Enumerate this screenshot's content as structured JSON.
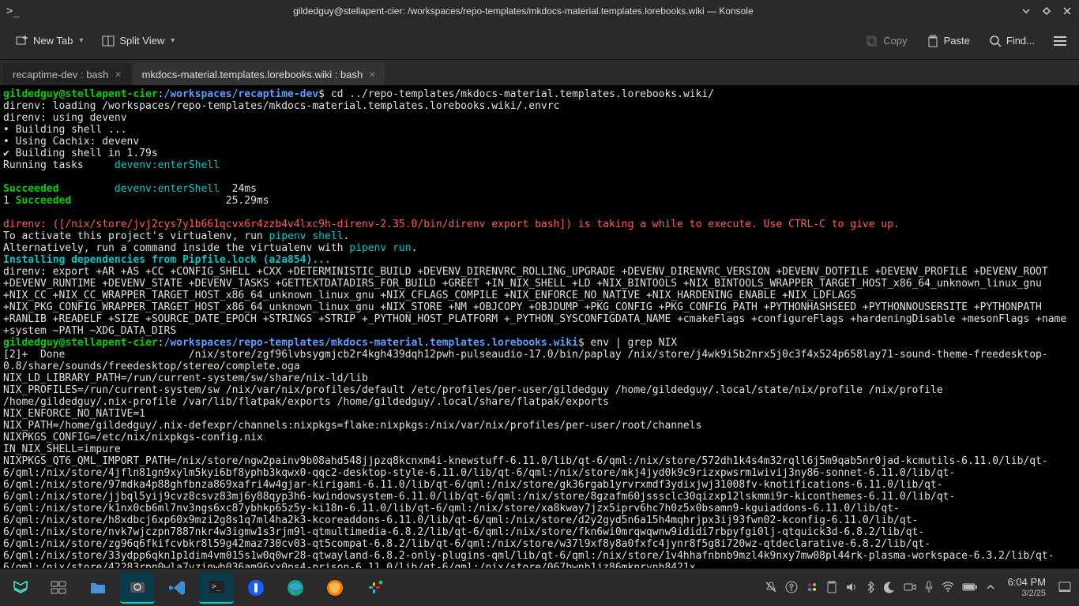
{
  "window": {
    "title": "gildedguy@stellapent-cier: /workspaces/repo-templates/mkdocs-material.templates.lorebooks.wiki — Konsole",
    "prompt_icon": ">_"
  },
  "toolbar": {
    "new_tab": "New Tab",
    "split_view": "Split View",
    "copy": "Copy",
    "paste": "Paste",
    "find": "Find..."
  },
  "tabs": [
    {
      "label": "recaptime-dev : bash",
      "active": false
    },
    {
      "label": "mkdocs-material.templates.lorebooks.wiki : bash",
      "active": true
    }
  ],
  "term": {
    "user_host": "gildedguy@stellapent-cier",
    "colon": ":",
    "path1": "/workspaces/recaptime-dev",
    "dollar": "$",
    "cmd1": " cd ../repo-templates/mkdocs-material.templates.lorebooks.wiki/",
    "l2": "direnv: loading /workspaces/repo-templates/mkdocs-material.templates.lorebooks.wiki/.envrc",
    "l3": "direnv: using devenv",
    "l4": "• Building shell ...",
    "l5": "• Using Cachix: devenv",
    "l6": "✔ Building shell in 1.79s",
    "l7a": "Running tasks     ",
    "devenv": "devenv:enterShell",
    "succ": "Succeeded",
    "succ_time1": "  24ms",
    "one": "1 ",
    "succ2": "Succeeded",
    "succ_time2": "                         25.29ms",
    "warn": "direnv: ([/nix/store/jvj2cys7y1b661qcvx6r4zzb4v4lxc9h-direnv-2.35.0/bin/direnv export bash]) is taking a while to execute. Use CTRL-C to give up.",
    "act1": "To activate this project's virtualenv, run ",
    "pipenv_shell": "pipenv shell",
    "dot": ".",
    "act2": "Alternatively, run a command inside the virtualenv with ",
    "pipenv_run": "pipenv run",
    "install": "Installing dependencies from Pipfile.lock (a2a854)...",
    "export": "direnv: export +AR +AS +CC +CONFIG_SHELL +CXX +DETERMINISTIC_BUILD +DEVENV_DIRENVRC_ROLLING_UPGRADE +DEVENV_DIRENVRC_VERSION +DEVENV_DOTFILE +DEVENV_PROFILE +DEVENV_ROOT +DEVENV_RUNTIME +DEVENV_STATE +DEVENV_TASKS +GETTEXTDATADIRS_FOR_BUILD +GREET +IN_NIX_SHELL +LD +NIX_BINTOOLS +NIX_BINTOOLS_WRAPPER_TARGET_HOST_x86_64_unknown_linux_gnu +NIX_CC +NIX_CC_WRAPPER_TARGET_HOST_x86_64_unknown_linux_gnu +NIX_CFLAGS_COMPILE +NIX_ENFORCE_NO_NATIVE +NIX_HARDENING_ENABLE +NIX_LDFLAGS +NIX_PKG_CONFIG_WRAPPER_TARGET_HOST_x86_64_unknown_linux_gnu +NIX_STORE +NM +OBJCOPY +OBJDUMP +PKG_CONFIG +PKG_CONFIG_PATH +PYTHONHASHSEED +PYTHONNOUSERSITE +PYTHONPATH +RANLIB +READELF +SIZE +SOURCE_DATE_EPOCH +STRINGS +STRIP +_PYTHON_HOST_PLATFORM +_PYTHON_SYSCONFIGDATA_NAME +cmakeFlags +configureFlags +hardeningDisable +mesonFlags +name +system ~PATH ~XDG_DATA_DIRS",
    "path2": "/workspaces/repo-templates/mkdocs-material.templates.lorebooks.wiki",
    "cmd2": " env | grep NIX",
    "env1": "[2]+  Done                    /nix/store/zgf96lvbsygmjcb2r4kgh439dqh12pwh-pulseaudio-17.0/bin/paplay /nix/store/j4wk9i5b2nrx5j0c3f4x524p658lay71-sound-theme-freedesktop-0.8/share/sounds/freedesktop/stereo/complete.oga",
    "env2": "NIX_LD_LIBRARY_PATH=/run/current-system/sw/share/nix-ld/lib",
    "env3": "NIX_PROFILES=/run/current-system/sw /nix/var/nix/profiles/default /etc/profiles/per-user/gildedguy /home/gildedguy/.local/state/nix/profile /nix/profile /home/gildedguy/.nix-profile /var/lib/flatpak/exports /home/gildedguy/.local/share/flatpak/exports",
    "env4": "NIX_ENFORCE_NO_NATIVE=1",
    "env5": "NIX_PATH=/home/gildedguy/.nix-defexpr/channels:nixpkgs=flake:nixpkgs:/nix/var/nix/profiles/per-user/root/channels",
    "env6": "NIXPKGS_CONFIG=/etc/nix/nixpkgs-config.nix",
    "env7": "IN_NIX_SHELL=impure",
    "env8": "NIXPKGS_QT6_QML_IMPORT_PATH=/nix/store/ngw2painv9b08ahd548jjpzq8kcnxm4i-knewstuff-6.11.0/lib/qt-6/qml:/nix/store/572dh1k4s4m32rqll6j5m9qab5nr0jad-kcmutils-6.11.0/lib/qt-6/qml:/nix/store/4jfln81gn9xylm5kyi6bf8yphb3kqwx0-qqc2-desktop-style-6.11.0/lib/qt-6/qml:/nix/store/mkj4jyd0k9c9rizxpwsrm1wivij3ny86-sonnet-6.11.0/lib/qt-6/qml:/nix/store/97mdka4p88ghfbnza869xafri4w4gjar-kirigami-6.11.0/lib/qt-6/qml:/nix/store/gk36rgab1yrvrxmdf3ydixjwj31008fv-knotifications-6.11.0/lib/qt-6/qml:/nix/store/jjbql5yij9cvz8csvz83mj6y88qyp3h6-kwindowsystem-6.11.0/lib/qt-6/qml:/nix/store/8gzafm60jsssclc30qizxp12lskmmi9r-kiconthemes-6.11.0/lib/qt-6/qml:/nix/store/k1nx0cb6ml7nv3ngs6xc87ybhkp65z5y-ki18n-6.11.0/lib/qt-6/qml:/nix/store/xa8kway7jzx5iprv6hc7h0z5x0bsamn9-kguiaddons-6.11.0/lib/qt-6/qml:/nix/store/h8xdbcj6xp60x9mzi2g8s1q7ml4ha2k3-kcoreaddons-6.11.0/lib/qt-6/qml:/nix/store/d2y2gyd5n6a15h4mqhrjpx3ij93fwn02-kconfig-6.11.0/lib/qt-6/qml:/nix/store/nvk7wjczpn7887nkr4w3igmw1s3rjm9l-qtmultimedia-6.8.2/lib/qt-6/qml:/nix/store/fkn6wi0mrqwqwnw9ididi7rbpyfgi0lj-qtquick3d-6.8.2/lib/qt-6/qml:/nix/store/zg96q6fkifcvbkr8l59g42maz730cv03-qt5compat-6.8.2/lib/qt-6/qml:/nix/store/w37l9xf8y8a0fxfc4jynr8f5g8i720wz-qtdeclarative-6.8.2/lib/qt-6/qml:/nix/store/33ydpp6qkn1p1dim4vm015s1w0q0wr28-qtwayland-6.8.2-only-plugins-qml/lib/qt-6/qml:/nix/store/1v4hhafnbnb9mzl4k9nxy7mw08pl44rk-plasma-workspace-6.3.2/lib/qt-6/qml:/nix/store/42283rpn0wla7vzinwh036am96xx0ps4-prison-6.11.0/lib/qt-6/qml:/nix/store/067bwnb1jz86mknrynh8421x"
  },
  "clock": {
    "time": "6:04 PM",
    "date": "3/2/25"
  }
}
